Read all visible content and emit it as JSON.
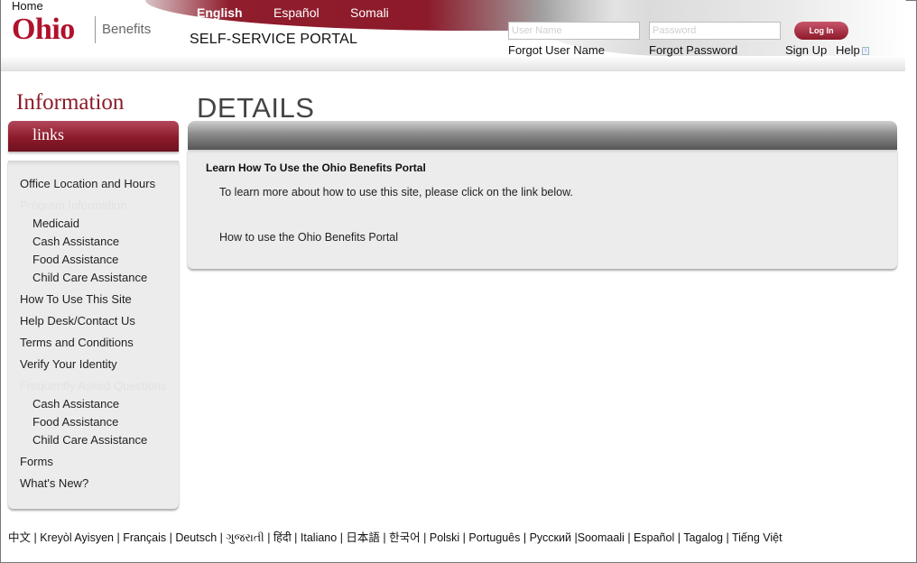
{
  "header": {
    "home": "Home",
    "logo_ohio": "Ohio",
    "logo_benefits": "Benefits",
    "portal_title": "SELF-SERVICE PORTAL",
    "languages": [
      {
        "label": "English",
        "active": true
      },
      {
        "label": "Español",
        "active": false
      },
      {
        "label": "Somali",
        "active": false
      }
    ],
    "username_placeholder": "User Name",
    "password_placeholder": "Password",
    "login_label": "Log In",
    "forgot_username": "Forgot User Name",
    "forgot_password": "Forgot Password",
    "sign_up": "Sign Up",
    "help": "Help",
    "help_icon_glyph": "i"
  },
  "sidebar": {
    "heading": "Information",
    "tab_label": "links",
    "items": [
      {
        "label": "Office Location and Hours",
        "indent": false,
        "faint": false
      },
      {
        "label": "Program Information",
        "indent": false,
        "faint": true
      },
      {
        "label": "Medicaid",
        "indent": true,
        "faint": false
      },
      {
        "label": "Cash Assistance",
        "indent": true,
        "faint": false
      },
      {
        "label": "Food Assistance",
        "indent": true,
        "faint": false
      },
      {
        "label": "Child Care Assistance",
        "indent": true,
        "faint": false
      },
      {
        "label": "How To Use This Site",
        "indent": false,
        "faint": false
      },
      {
        "label": "Help Desk/Contact Us",
        "indent": false,
        "faint": false
      },
      {
        "label": "Terms and Conditions",
        "indent": false,
        "faint": false
      },
      {
        "label": "Verify Your Identity",
        "indent": false,
        "faint": false
      },
      {
        "label": "Frequently Asked Questions",
        "indent": false,
        "faint": true
      },
      {
        "label": "Cash Assistance",
        "indent": true,
        "faint": false
      },
      {
        "label": "Food Assistance",
        "indent": true,
        "faint": false
      },
      {
        "label": "Child Care Assistance",
        "indent": true,
        "faint": false
      },
      {
        "label": "Forms",
        "indent": false,
        "faint": false
      },
      {
        "label": "What's New?",
        "indent": false,
        "faint": false
      }
    ]
  },
  "main": {
    "title": "DETAILS",
    "section_heading": "Learn How To Use the Ohio Benefits Portal",
    "intro_text": "To learn more about how to use this site, please click on the link below.",
    "link_text": "How to use the Ohio Benefits Portal"
  },
  "footer": {
    "languages": [
      "中文",
      "Kreyòl Ayisyen",
      "Français",
      "Deutsch",
      "ગુજરાતી",
      "हिंदी",
      "Italiano",
      "日本語",
      "한국어",
      "Polski",
      "Português",
      "Русский",
      "Soomaali",
      "Español",
      "Tagalog",
      "Tiếng Việt"
    ]
  }
}
